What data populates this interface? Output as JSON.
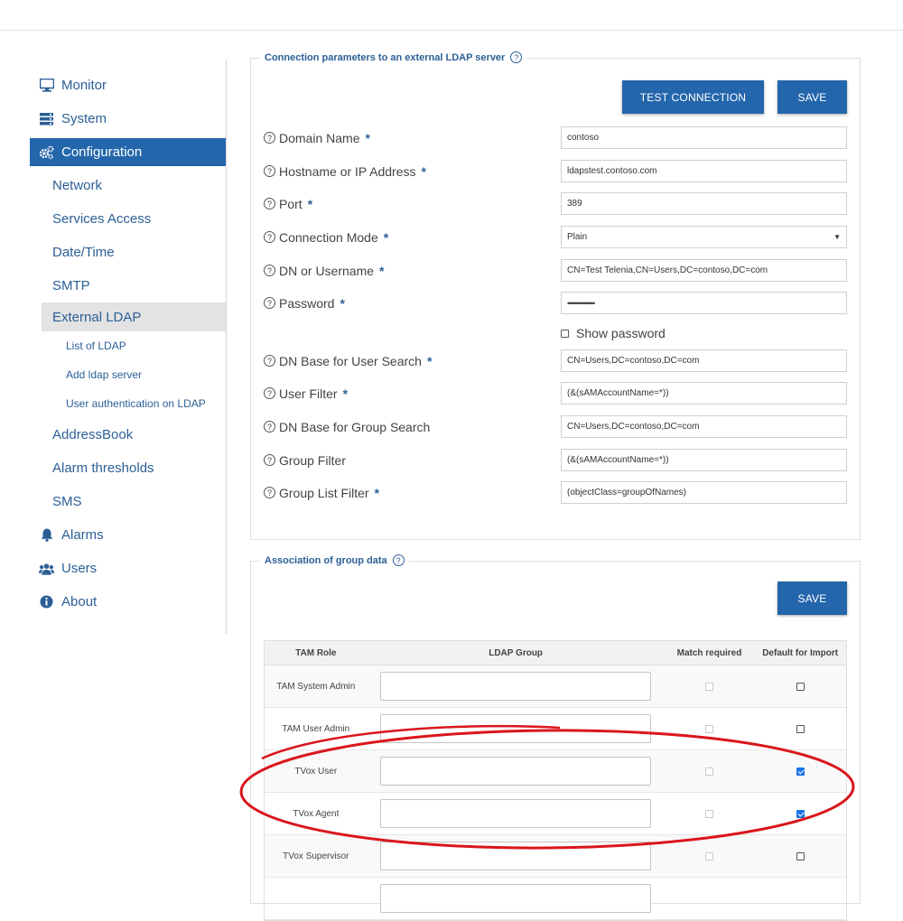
{
  "sidebar": {
    "items": [
      {
        "label": "Monitor"
      },
      {
        "label": "System"
      },
      {
        "label": "Configuration"
      },
      {
        "label": "Network"
      },
      {
        "label": "Services Access"
      },
      {
        "label": "Date/Time"
      },
      {
        "label": "SMTP"
      },
      {
        "label": "External LDAP"
      },
      {
        "label": "List of LDAP"
      },
      {
        "label": "Add ldap server"
      },
      {
        "label": "User authentication on LDAP"
      },
      {
        "label": "AddressBook"
      },
      {
        "label": "Alarm thresholds"
      },
      {
        "label": "SMS"
      },
      {
        "label": "Alarms"
      },
      {
        "label": "Users"
      },
      {
        "label": "About"
      }
    ]
  },
  "connection": {
    "legend": "Connection parameters to an external LDAP server",
    "test_label": "TEST CONNECTION",
    "save_label": "SAVE",
    "help_glyph": "?",
    "required_mark": "*",
    "fields": [
      {
        "label": "Domain Name",
        "value": "contoso"
      },
      {
        "label": "Hostname or IP Address",
        "value": "ldapstest.contoso.com"
      },
      {
        "label": "Port",
        "value": "389"
      },
      {
        "label": "Connection Mode",
        "value": "Plain"
      },
      {
        "label": "DN or Username",
        "value": "CN=Test Telenia,CN=Users,DC=contoso,DC=com"
      },
      {
        "label": "Password",
        "value": "••••••••••••••"
      },
      {
        "label": "DN Base for User Search",
        "value": "CN=Users,DC=contoso,DC=com"
      },
      {
        "label": "User Filter",
        "value": "(&(sAMAccountName=*))"
      },
      {
        "label": "DN Base for Group Search",
        "value": "CN=Users,DC=contoso,DC=com"
      },
      {
        "label": "Group Filter",
        "value": "(&(sAMAccountName=*))"
      },
      {
        "label": "Group List Filter",
        "value": "(objectClass=groupOfNames)"
      }
    ],
    "show_password_label": "Show password"
  },
  "association": {
    "legend": "Association of group data",
    "save_label": "SAVE",
    "columns": [
      "TAM Role",
      "LDAP Group",
      "Match required",
      "Default for Import"
    ],
    "rows": [
      {
        "role": "TAM System Admin",
        "default_checked": false
      },
      {
        "role": "TAM User Admin",
        "default_checked": false
      },
      {
        "role": "TVox User",
        "default_checked": true
      },
      {
        "role": "TVox Agent",
        "default_checked": true
      },
      {
        "role": "TVox Supervisor",
        "default_checked": false
      }
    ]
  },
  "colors": {
    "accent": "#2466ab",
    "link": "#2b5f96",
    "annotation": "#d9161c"
  }
}
